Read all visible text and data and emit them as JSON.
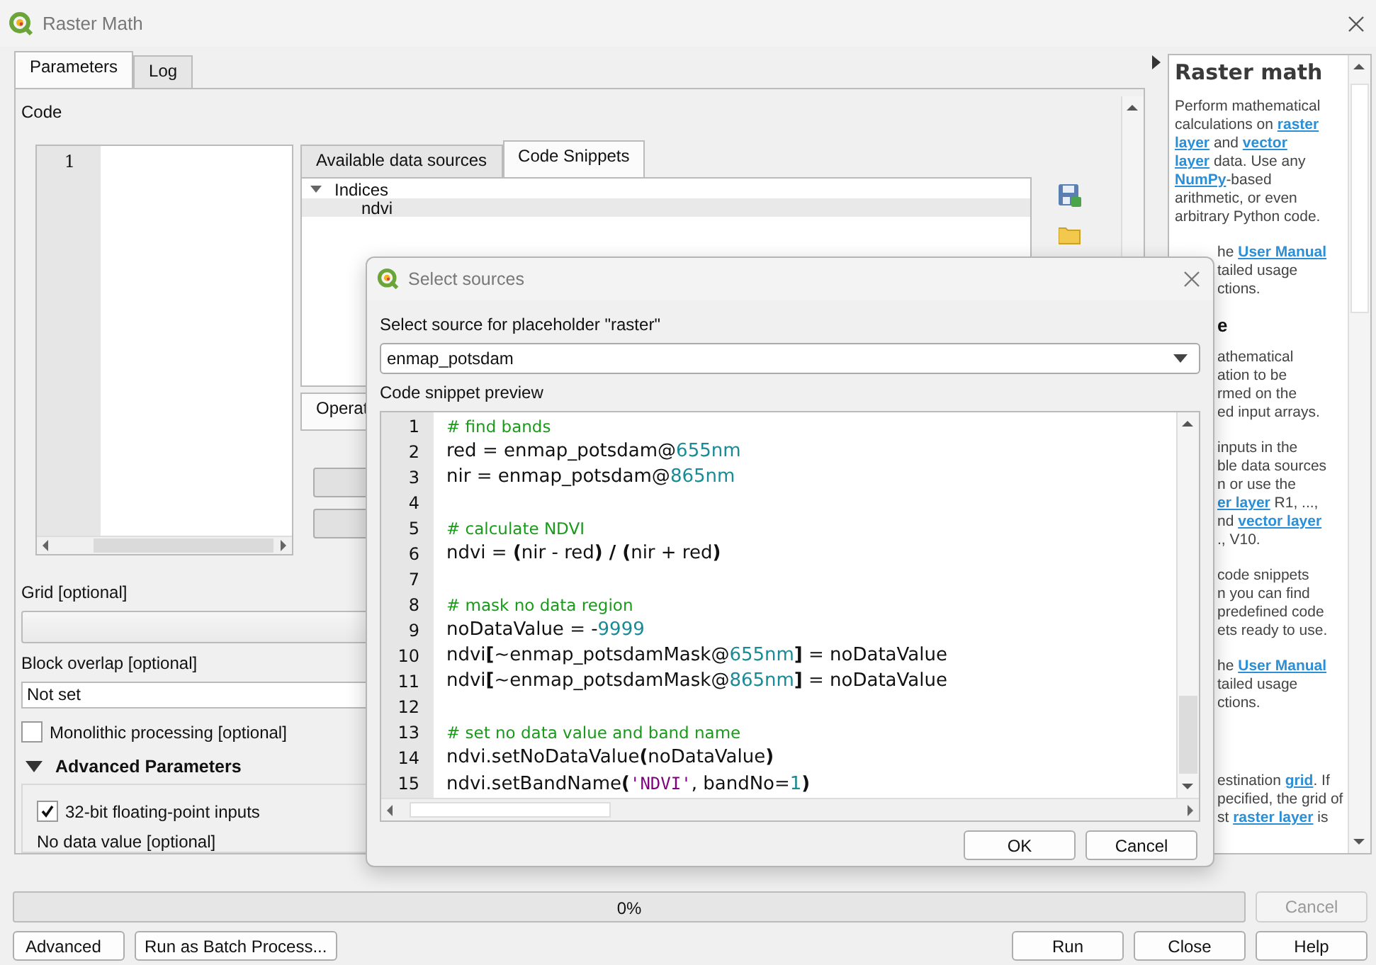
{
  "window": {
    "title": "Raster Math"
  },
  "tabs": [
    {
      "label": "Parameters",
      "selected": true
    },
    {
      "label": "Log",
      "selected": false
    }
  ],
  "code": {
    "label": "Code",
    "line_numbers": [
      "1"
    ]
  },
  "source_tabs": [
    {
      "label": "Available data sources",
      "selected": false
    },
    {
      "label": "Code Snippets",
      "selected": true
    }
  ],
  "snippet_tree": [
    {
      "label": "Indices",
      "expanded": true,
      "children": [
        {
          "label": "ndvi",
          "selected": true
        }
      ]
    }
  ],
  "lower_tabs": [
    {
      "label": "Operat",
      "selected": true
    }
  ],
  "grid": {
    "label": "Grid [optional]"
  },
  "block_overlap": {
    "label": "Block overlap [optional]",
    "value": "Not set"
  },
  "monolithic": {
    "label": "Monolithic processing [optional]",
    "checked": false
  },
  "advanced": {
    "label": "Advanced Parameters",
    "expanded": true,
    "float32": {
      "label": "32-bit floating-point inputs",
      "checked": true
    },
    "no_data_label": "No data value [optional]"
  },
  "help": {
    "title": "Raster math",
    "paragraphs": [
      {
        "kind": "text",
        "covered": false,
        "lines": [
          [
            {
              "t": "Perform mathematical",
              "link": false
            }
          ],
          [
            {
              "t": "calculations on ",
              "link": false
            },
            {
              "t": "raster",
              "link": true
            }
          ],
          [
            {
              "t": "layer",
              "link": true
            },
            {
              "t": " and ",
              "link": false
            },
            {
              "t": "vector",
              "link": true
            }
          ],
          [
            {
              "t": "layer",
              "link": true
            },
            {
              "t": " data. Use any",
              "link": false
            }
          ],
          [
            {
              "t": "NumPy",
              "link": true
            },
            {
              "t": "-based",
              "link": false
            }
          ],
          [
            {
              "t": "arithmetic, or even",
              "link": false
            }
          ],
          [
            {
              "t": "arbitrary Python code.",
              "link": false
            }
          ]
        ]
      },
      {
        "kind": "text",
        "covered": true,
        "lines": [
          [
            {
              "t": "he ",
              "link": false
            },
            {
              "t": "User Manual",
              "link": true
            }
          ],
          [
            {
              "t": "tailed usage",
              "link": false
            }
          ],
          [
            {
              "t": "ctions.",
              "link": false
            }
          ]
        ]
      },
      {
        "kind": "heading",
        "covered": true,
        "lines": [
          [
            {
              "t": "e",
              "link": false
            }
          ]
        ]
      },
      {
        "kind": "text",
        "covered": true,
        "lines": [
          [
            {
              "t": "athematical",
              "link": false
            }
          ],
          [
            {
              "t": "ation to be",
              "link": false
            }
          ],
          [
            {
              "t": "rmed on the",
              "link": false
            }
          ],
          [
            {
              "t": "ed input arrays.",
              "link": false
            }
          ]
        ]
      },
      {
        "kind": "text",
        "covered": true,
        "lines": [
          [
            {
              "t": "inputs in the",
              "link": false
            }
          ],
          [
            {
              "t": "ble data sources",
              "link": false
            }
          ],
          [
            {
              "t": "n or use the",
              "link": false
            }
          ],
          [
            {
              "t": "er layer",
              "link": true
            },
            {
              "t": " R1, ...,",
              "link": false
            }
          ],
          [
            {
              "t": "nd ",
              "link": false
            },
            {
              "t": "vector layer",
              "link": true
            }
          ],
          [
            {
              "t": "., V10.",
              "link": false
            }
          ]
        ]
      },
      {
        "kind": "text",
        "covered": true,
        "lines": [
          [
            {
              "t": "code snippets",
              "link": false
            }
          ],
          [
            {
              "t": "n you can find",
              "link": false
            }
          ],
          [
            {
              "t": "predefined code",
              "link": false
            }
          ],
          [
            {
              "t": "ets ready to use.",
              "link": false
            }
          ]
        ]
      },
      {
        "kind": "text",
        "covered": true,
        "lines": [
          [
            {
              "t": "he ",
              "link": false
            },
            {
              "t": "User Manual",
              "link": true
            }
          ],
          [
            {
              "t": "tailed usage",
              "link": false
            }
          ],
          [
            {
              "t": "ctions.",
              "link": false
            }
          ]
        ]
      },
      {
        "kind": "text",
        "covered": true,
        "lines": [
          [
            {
              "t": "estination ",
              "link": false
            },
            {
              "t": "grid",
              "link": true
            },
            {
              "t": ". If",
              "link": false
            }
          ],
          [
            {
              "t": "pecified, the grid of",
              "link": false
            }
          ],
          [
            {
              "t": "st ",
              "link": false
            },
            {
              "t": "raster layer",
              "link": true
            },
            {
              "t": " is",
              "link": false
            }
          ]
        ]
      }
    ]
  },
  "progress": {
    "level": 0,
    "text": "0%"
  },
  "cancel": {
    "label": "Cancel",
    "disabled": true
  },
  "buttons_left": [
    {
      "label": "Advanced",
      "kind": "dropdown"
    },
    {
      "label": "Run as Batch Process...",
      "kind": "plain"
    }
  ],
  "buttons_right": [
    "Run",
    "Close",
    "Help"
  ],
  "dialog": {
    "title": "Select sources",
    "source_label": "Select source for placeholder \"raster\"",
    "source_value": "enmap_potsdam",
    "preview_label": "Code snippet preview",
    "lines": [
      {
        "n": "1",
        "tokens": [
          {
            "t": "# find bands",
            "kind": "comment"
          }
        ]
      },
      {
        "n": "2",
        "tokens": [
          {
            "t": "red = enmap_potsdam@",
            "kind": "text"
          },
          {
            "t": "655nm",
            "kind": "number"
          }
        ]
      },
      {
        "n": "3",
        "tokens": [
          {
            "t": "nir = enmap_potsdam@",
            "kind": "text"
          },
          {
            "t": "865nm",
            "kind": "number"
          }
        ]
      },
      {
        "n": "4"
      },
      {
        "n": "5",
        "tokens": [
          {
            "t": "# calculate NDVI",
            "kind": "comment"
          }
        ]
      },
      {
        "n": "6",
        "tokens": [
          {
            "t": "ndvi = ",
            "kind": "text"
          },
          {
            "t": "(",
            "kind": "bold"
          },
          {
            "t": "nir - red",
            "kind": "text"
          },
          {
            "t": ") / (",
            "kind": "bold"
          },
          {
            "t": "nir + red",
            "kind": "text"
          },
          {
            "t": ")",
            "kind": "bold"
          }
        ]
      },
      {
        "n": "7"
      },
      {
        "n": "8",
        "tokens": [
          {
            "t": "# mask no data region",
            "kind": "comment"
          }
        ]
      },
      {
        "n": "9",
        "tokens": [
          {
            "t": "noDataValue = -",
            "kind": "text"
          },
          {
            "t": "9999",
            "kind": "number"
          }
        ]
      },
      {
        "n": "10",
        "tokens": [
          {
            "t": "ndvi",
            "kind": "text"
          },
          {
            "t": "[",
            "kind": "bold"
          },
          {
            "t": "~enmap_potsdamMask@",
            "kind": "text"
          },
          {
            "t": "655nm",
            "kind": "number"
          },
          {
            "t": "]",
            "kind": "bold"
          },
          {
            "t": " = noDataValue",
            "kind": "text"
          }
        ]
      },
      {
        "n": "11",
        "tokens": [
          {
            "t": "ndvi",
            "kind": "text"
          },
          {
            "t": "[",
            "kind": "bold"
          },
          {
            "t": "~enmap_potsdamMask@",
            "kind": "text"
          },
          {
            "t": "865nm",
            "kind": "number"
          },
          {
            "t": "]",
            "kind": "bold"
          },
          {
            "t": " = noDataValue",
            "kind": "text"
          }
        ]
      },
      {
        "n": "12"
      },
      {
        "n": "13",
        "tokens": [
          {
            "t": "# set no data value and band name",
            "kind": "comment"
          }
        ]
      },
      {
        "n": "14",
        "tokens": [
          {
            "t": "ndvi.setNoDataValue",
            "kind": "text"
          },
          {
            "t": "(",
            "kind": "bold"
          },
          {
            "t": "noDataValue",
            "kind": "text"
          },
          {
            "t": ")",
            "kind": "bold"
          }
        ]
      },
      {
        "n": "15",
        "tokens": [
          {
            "t": "ndvi.setBandName",
            "kind": "text"
          },
          {
            "t": "(",
            "kind": "bold"
          },
          {
            "t": "'NDVI'",
            "kind": "string"
          },
          {
            "t": ", bandNo=",
            "kind": "text"
          },
          {
            "t": "1",
            "kind": "number"
          },
          {
            "t": ")",
            "kind": "bold"
          }
        ]
      }
    ],
    "buttons": [
      "OK",
      "Cancel"
    ]
  }
}
